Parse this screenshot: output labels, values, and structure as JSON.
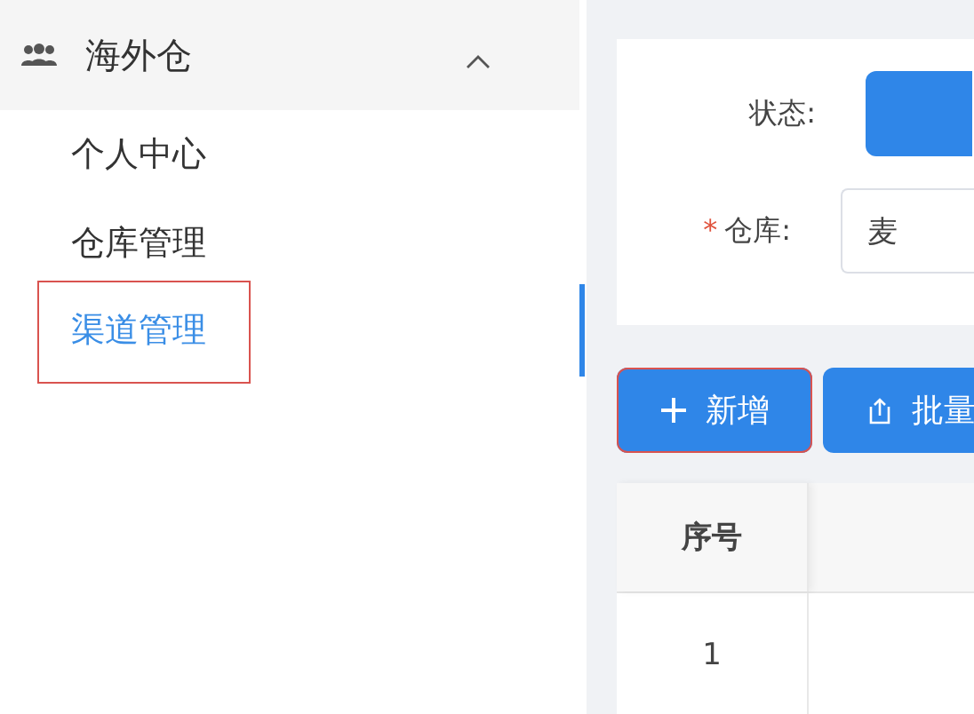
{
  "sidebar": {
    "group": {
      "label": "海外仓",
      "expanded": true
    },
    "items": [
      {
        "label": "个人中心",
        "selected": false,
        "highlighted": false
      },
      {
        "label": "仓库管理",
        "selected": false,
        "highlighted": false
      },
      {
        "label": "渠道管理",
        "selected": true,
        "highlighted": true
      }
    ]
  },
  "filter": {
    "fields": [
      {
        "kind": "buttons",
        "label": "状态:"
      },
      {
        "kind": "select",
        "label": "仓库:",
        "required_mark": "*",
        "value": "麦"
      }
    ]
  },
  "toolbar": [
    {
      "kind": "add",
      "label": "新增",
      "highlighted": true
    },
    {
      "kind": "upload",
      "label": "批量",
      "highlighted": false
    }
  ],
  "table": {
    "columns": [
      "序号"
    ],
    "rows": [
      [
        "1"
      ]
    ]
  }
}
